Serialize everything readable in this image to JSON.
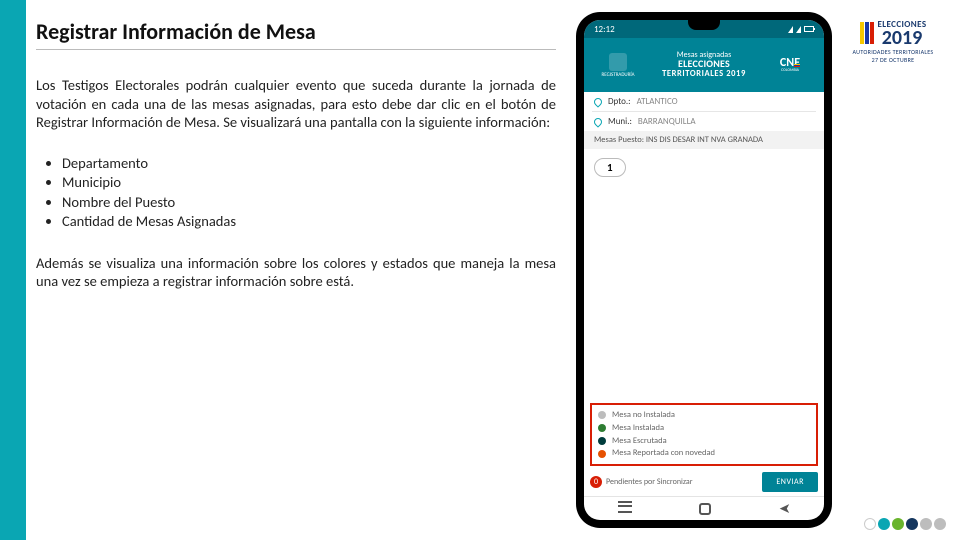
{
  "title": "Registrar Información de Mesa",
  "paragraph1": "Los Testigos Electorales podrán cualquier evento que suceda durante la jornada de votación en cada una de las mesas asignadas, para esto debe dar clic en el botón de Registrar Información de Mesa. Se visualizará una pantalla con la siguiente información:",
  "bullets": {
    "b0": "Departamento",
    "b1": "Municipio",
    "b2": "Nombre del Puesto",
    "b3": "Cantidad de Mesas Asignadas"
  },
  "paragraph2": "Además se visualiza una información sobre los colores y estados que maneja la mesa una vez se empieza a registrar información sobre está.",
  "brand": {
    "word": "ELECCIONES",
    "year": "2019",
    "sub1": "AUTORIDADES TERRITORIALES",
    "sub2": "27 DE OCTUBRE",
    "flag": {
      "c0": "#f6c700",
      "c1": "#1838a8",
      "c2": "#d81e05"
    }
  },
  "phone": {
    "status_time": "12:12",
    "appbar": {
      "left_caption": "REGISTRADURÍA",
      "top": "Mesas asignadas",
      "mid": "ELECCIONES",
      "bot": "TERRITORIALES 2019",
      "right": "CNE"
    },
    "dpto_label": "Dpto.:",
    "dpto_value": "ATLANTICO",
    "muni_label": "Muni.:",
    "muni_value": "BARRANQUILLA",
    "mesas_header": "Mesas Puesto: INS DIS DESAR INT NVA GRANADA",
    "chip1": "1",
    "legend": {
      "l0": "Mesa no Instalada",
      "l1": "Mesa Instalada",
      "l2": "Mesa Escrutada",
      "l3": "Mesa Reportada con novedad",
      "c0": "#bdbdbd",
      "c1": "#2e7d32",
      "c2": "#003c3c",
      "c3": "#e65100"
    },
    "pending_badge": "0",
    "pending_label": "Pendientes por Sincronizar",
    "send": "ENVIAR"
  },
  "dots": {
    "c0": "#ffffff",
    "c1": "#0aa6b3",
    "c2": "#6ab42d",
    "c3": "#14365e",
    "c4": "#bdbdbd",
    "c5": "#bdbdbd"
  }
}
